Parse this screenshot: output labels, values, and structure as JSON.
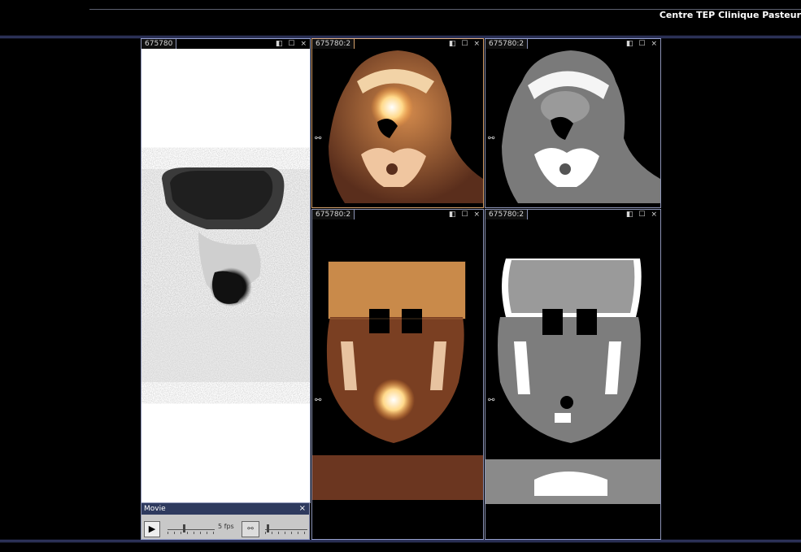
{
  "header": {
    "site_name": "Centre TEP Clinique Pasteur"
  },
  "viewers": [
    {
      "id": "mip",
      "title": "675780",
      "controls": [
        "window-icon",
        "maximize-icon",
        "close-icon"
      ]
    },
    {
      "id": "fused-axial",
      "title": "675780:2"
    },
    {
      "id": "ct-axial",
      "title": "675780:2"
    },
    {
      "id": "fused-coronal",
      "title": "675780:2"
    },
    {
      "id": "ct-coronal",
      "title": "675780:2"
    }
  ],
  "icons": {
    "restore": "◧",
    "maximize": "☐",
    "close": "×",
    "link": "⚯"
  },
  "movie": {
    "title": "Movie",
    "close": "×",
    "play": "▶",
    "fps": "5 fps",
    "speed_level": 0.35
  }
}
